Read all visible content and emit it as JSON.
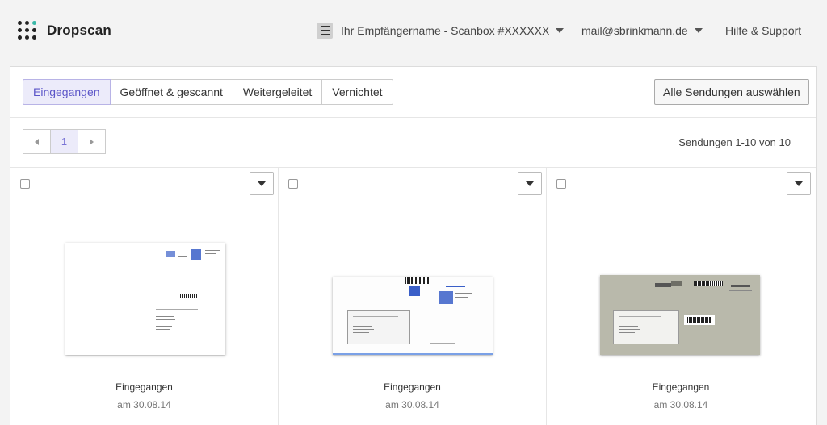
{
  "brand": {
    "name": "Dropscan",
    "dot_colors": [
      "#222222",
      "#222222",
      "#3ab8a8",
      "#222222",
      "#222222",
      "#222222",
      "#222222",
      "#222222",
      "#222222"
    ]
  },
  "header": {
    "recipient_label": "Ihr Empfängername - Scanbox #XXXXXX",
    "recipient_icon": "hamburger-icon",
    "account_label": "mail@sbrinkmann.de",
    "help_label": "Hilfe & Support"
  },
  "tabs": [
    {
      "label": "Eingegangen",
      "active": true
    },
    {
      "label": "Geöffnet & gescannt",
      "active": false
    },
    {
      "label": "Weitergeleitet",
      "active": false
    },
    {
      "label": "Vernichtet",
      "active": false
    }
  ],
  "toolbar": {
    "select_all_label": "Alle Sendungen auswählen"
  },
  "pagination": {
    "prev_icon": "caret-left-icon",
    "current_page": "1",
    "next_icon": "caret-right-icon",
    "count_label": "Sendungen 1-10 von 10"
  },
  "colors": {
    "accent": "#5b55c8",
    "accent_bg": "#ecebfa"
  },
  "cards": [
    {
      "status": "Eingegangen",
      "date": "am 30.08.14",
      "envelope": "white-letter"
    },
    {
      "status": "Eingegangen",
      "date": "am 30.08.14",
      "envelope": "window-envelope-ihk"
    },
    {
      "status": "Eingegangen",
      "date": "am 30.08.14",
      "envelope": "grey-envelope"
    }
  ]
}
